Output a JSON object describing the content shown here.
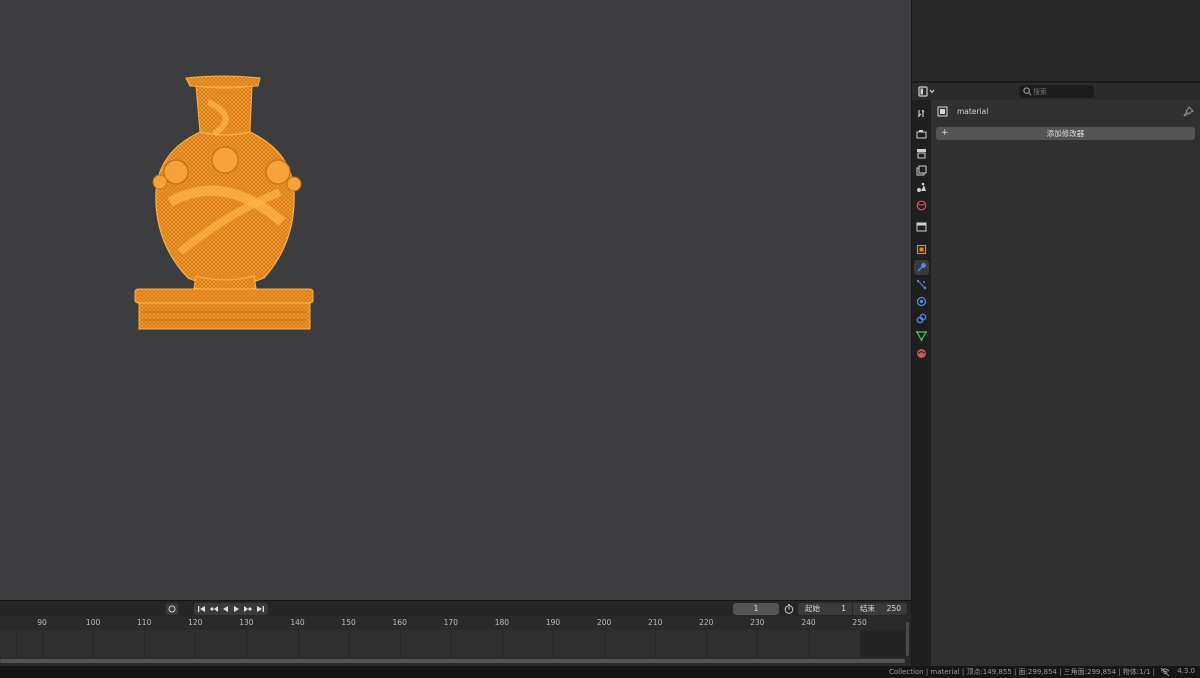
{
  "properties": {
    "search_placeholder": "搜索",
    "object_name": "material",
    "add_modifier_label": "添加修改器"
  },
  "tabs": [
    {
      "name": "tool-icon",
      "color": "#cfcfcf"
    },
    {
      "name": "render-icon",
      "color": "#cfcfcf"
    },
    {
      "name": "output-icon",
      "color": "#cfcfcf"
    },
    {
      "name": "view-layer-icon",
      "color": "#cfcfcf"
    },
    {
      "name": "scene-icon",
      "color": "#cfcfcf"
    },
    {
      "name": "world-icon",
      "color": "#d2545e"
    },
    {
      "name": "collection-icon",
      "color": "#cfcfcf"
    },
    {
      "name": "object-icon",
      "color": "#e8872b"
    },
    {
      "name": "modifier-icon",
      "color": "#4f8fe0"
    },
    {
      "name": "particles-icon",
      "color": "#4f8fe0"
    },
    {
      "name": "physics-icon",
      "color": "#4f8fe0"
    },
    {
      "name": "constraints-icon",
      "color": "#4f8fe0"
    },
    {
      "name": "data-icon",
      "color": "#43c76b"
    },
    {
      "name": "material-icon",
      "color": "#d2545e"
    }
  ],
  "timeline": {
    "current_frame": "1",
    "start_label": "起始",
    "start_value": "1",
    "end_label": "结束",
    "end_value": "250",
    "ticks": [
      "90",
      "100",
      "110",
      "120",
      "130",
      "140",
      "150",
      "160",
      "170",
      "180",
      "190",
      "200",
      "210",
      "220",
      "230",
      "240",
      "250"
    ]
  },
  "status": {
    "text": "Collection | material | 顶点:149,855 | 面:299,854 | 三角面:299,854 | 物体:1/1 |",
    "version": "4.3.0"
  },
  "colors": {
    "accent_orange": "#e8872b",
    "viewport_bg": "#3d3d3f"
  }
}
